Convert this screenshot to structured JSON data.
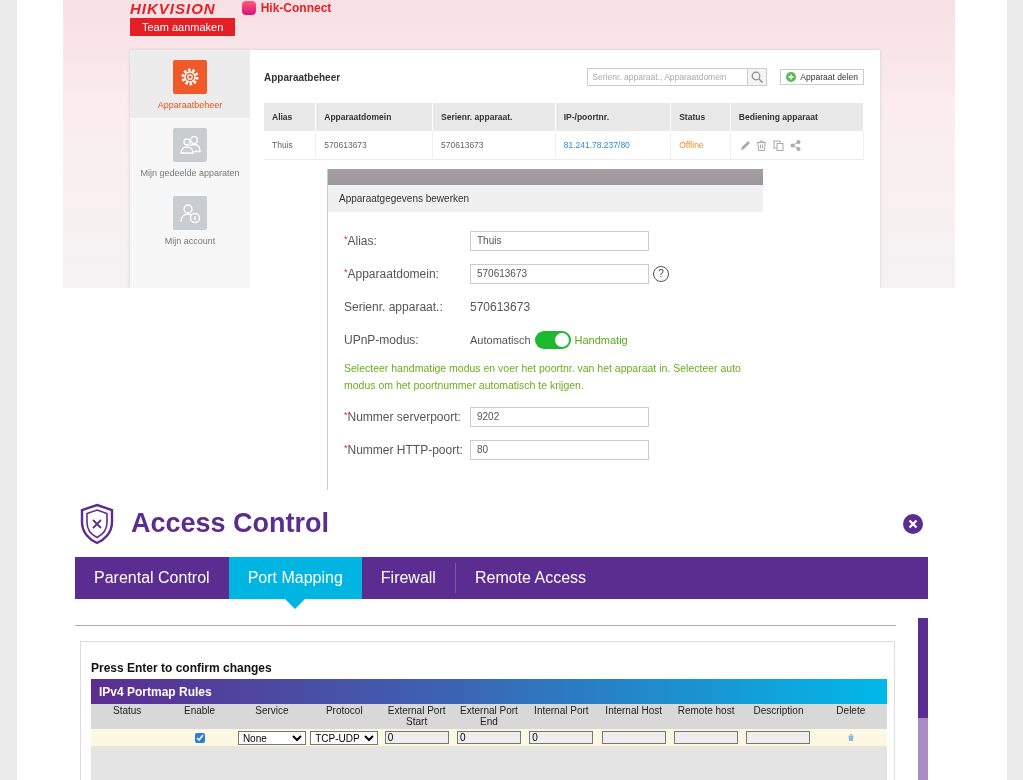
{
  "hikconnect": {
    "logo": "HIKVISION",
    "app_name": "Hik-Connect",
    "team_button": "Team aanmaken",
    "sidebar": [
      {
        "label": "Apparaatbeheer",
        "selected": true,
        "kind": "gear"
      },
      {
        "label": "Mijn gedeelde apparaten",
        "selected": false,
        "kind": "users"
      },
      {
        "label": "Mijn account",
        "selected": false,
        "kind": "account"
      }
    ],
    "title": "Apparaatbeheer",
    "search": {
      "placeholder": "Serienr. apparaat., Apparaatdomein"
    },
    "share_button": "Apparaat delen",
    "table": {
      "columns": [
        "Alias",
        "Apparaatdomein",
        "Serienr. apparaat.",
        "IP-/poortnr.",
        "Status",
        "Bediening apparaat"
      ],
      "rows": [
        {
          "alias": "Thuis",
          "domain": "570613673",
          "serial": "570613673",
          "ip": "81.241.78.237/80",
          "status": "Offline"
        }
      ]
    }
  },
  "dialog": {
    "title": "Apparaatgegevens bewerken",
    "fields": [
      {
        "kind": "input",
        "mark": "*",
        "label": "Alias:",
        "value": "Thuis"
      },
      {
        "kind": "input",
        "mark": "*",
        "label": "Apparaatdomein:",
        "value": "570613673",
        "help": "?"
      },
      {
        "kind": "text",
        "label": "Serienr. apparaat.:",
        "value": "570613673"
      },
      {
        "kind": "toggle",
        "label": "UPnP-modus:",
        "off_label": "Automatisch",
        "on_label": "Handmatig",
        "on": true
      },
      {
        "kind": "hint",
        "text": "Selecteer handmatige modus en voer het poortnr. van het apparaat in. Selecteer auto modus om het poortnummer automatisch te krijgen."
      },
      {
        "kind": "input",
        "mark": "*",
        "label": "Nummer serverpoort:",
        "value": "9202"
      },
      {
        "kind": "input",
        "mark": "*",
        "label": "Nummer HTTP-poort:",
        "value": "80"
      }
    ]
  },
  "access_control": {
    "title": "Access Control",
    "tabs": [
      {
        "label": "Parental Control",
        "selected": false
      },
      {
        "label": "Port Mapping",
        "selected": true
      },
      {
        "label": "Firewall",
        "selected": false
      },
      {
        "label": "Remote Access",
        "selected": false
      }
    ],
    "notice": "Press Enter to confirm changes",
    "rules": {
      "title": "IPv4 Portmap Rules",
      "columns": [
        "Status",
        "Enable",
        "Service",
        "Protocol",
        "External Port Start",
        "External Port End",
        "Internal Port",
        "Internal Host",
        "Remote host",
        "Description",
        "Delete"
      ],
      "rows": [
        {
          "enabled": true,
          "service": "None",
          "protocol": "TCP-UDP",
          "ext_start": "0",
          "ext_end": "0",
          "int_port": "0"
        }
      ]
    }
  }
}
